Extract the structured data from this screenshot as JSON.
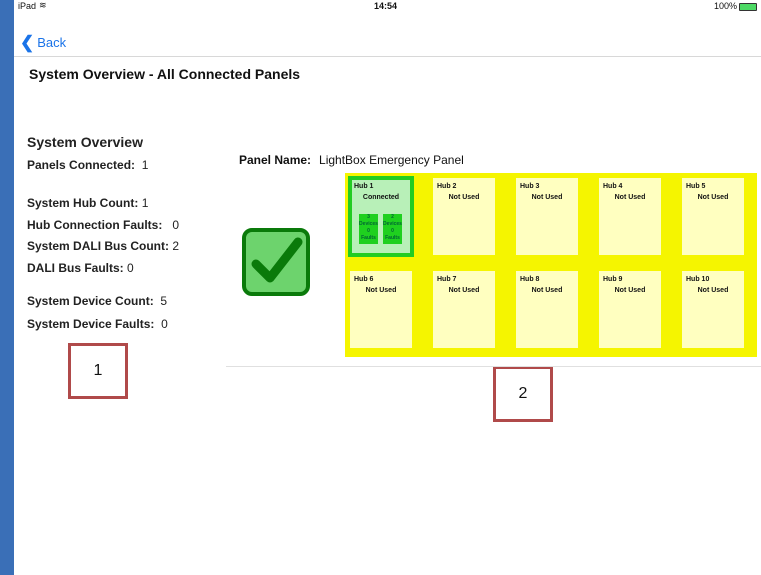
{
  "statusbar": {
    "carrier": "iPad",
    "time": "14:54",
    "battery": "100%"
  },
  "nav": {
    "back_label": "Back"
  },
  "page_title": "System Overview - All Connected Panels",
  "overview": {
    "heading": "System Overview",
    "panels_connected_label": "Panels Connected:",
    "panels_connected": "1",
    "hub_count_label": "System Hub Count:",
    "hub_count": "1",
    "hub_faults_label": "Hub Connection Faults:",
    "hub_faults": "0",
    "dali_bus_count_label": "System DALI Bus Count:",
    "dali_bus_count": "2",
    "dali_bus_faults_label": "DALI Bus Faults:",
    "dali_bus_faults": "0",
    "device_count_label": "System Device Count:",
    "device_count": "5",
    "device_faults_label": "System Device Faults:",
    "device_faults": "0"
  },
  "panel": {
    "name_label": "Panel Name:",
    "name": "LightBox Emergency Panel",
    "status": "ok"
  },
  "hubs": [
    {
      "name": "Hub 1",
      "status": "Connected",
      "buses": [
        {
          "devices": "3",
          "devices_label": "Devices",
          "faults": "0",
          "faults_label": "Faults"
        },
        {
          "devices": "2",
          "devices_label": "Devices",
          "faults": "0",
          "faults_label": "Faults"
        }
      ]
    },
    {
      "name": "Hub 2",
      "status": "Not Used"
    },
    {
      "name": "Hub 3",
      "status": "Not Used"
    },
    {
      "name": "Hub 4",
      "status": "Not Used"
    },
    {
      "name": "Hub 5",
      "status": "Not Used"
    },
    {
      "name": "Hub 6",
      "status": "Not Used"
    },
    {
      "name": "Hub 7",
      "status": "Not Used"
    },
    {
      "name": "Hub 8",
      "status": "Not Used"
    },
    {
      "name": "Hub 9",
      "status": "Not Used"
    },
    {
      "name": "Hub 10",
      "status": "Not Used"
    }
  ],
  "annotations": {
    "marker_1": "1",
    "marker_2": "2"
  },
  "colors": {
    "accent": "#1a73e8",
    "hub_grid": "#f5f500",
    "hub_unused": "#ffffc0",
    "hub_connected": "#22cc22",
    "ok_green": "#0a7a0a",
    "marker_border": "#b04a4a"
  }
}
